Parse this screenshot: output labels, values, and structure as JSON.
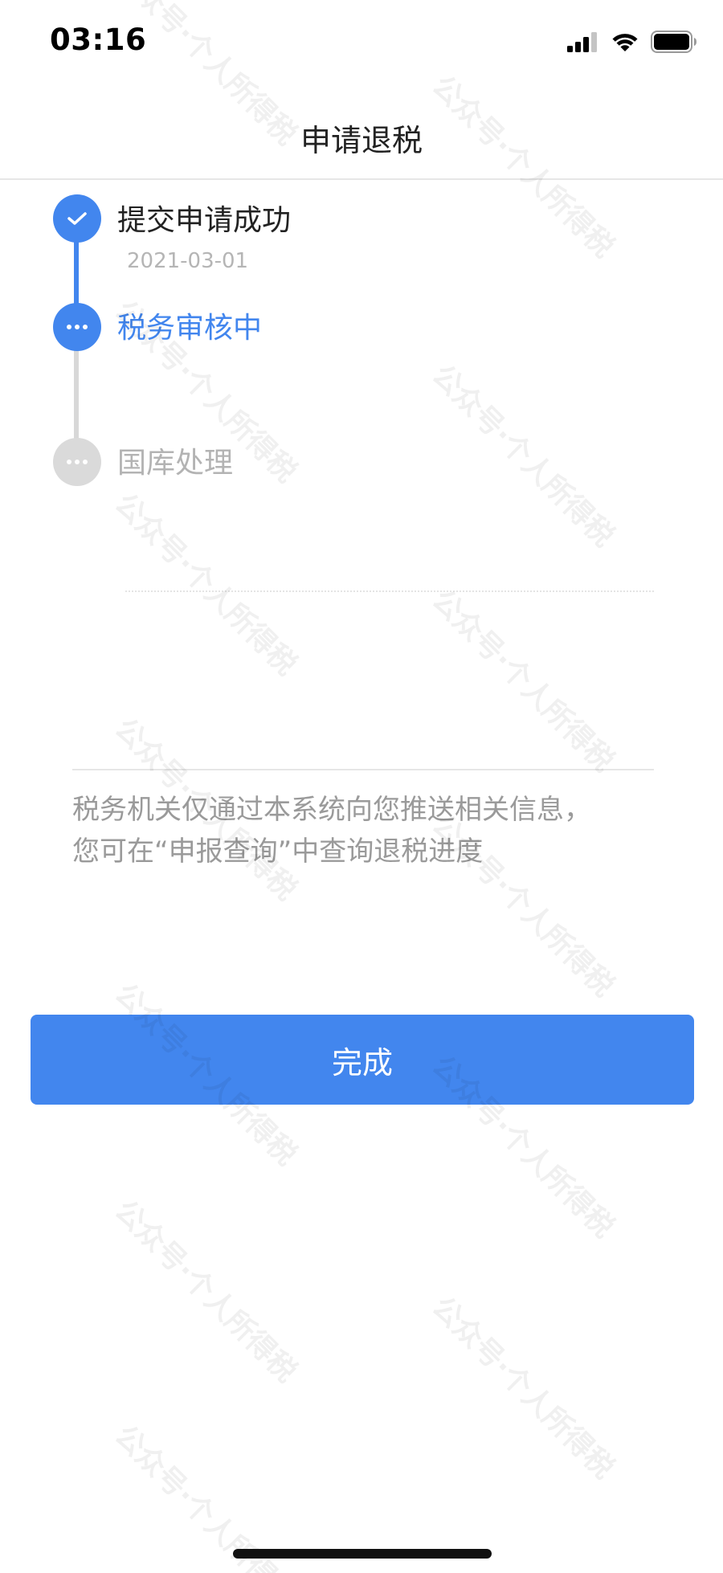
{
  "status_bar": {
    "time": "03:16",
    "icons": [
      "cellular-signal-icon",
      "wifi-icon",
      "battery-icon"
    ]
  },
  "nav": {
    "title": "申请退税"
  },
  "timeline": {
    "steps": [
      {
        "title": "提交申请成功",
        "date": "2021-03-01",
        "state": "done",
        "icon": "check-icon"
      },
      {
        "title": "税务审核中",
        "state": "active",
        "icon": "more-dots-icon"
      },
      {
        "title": "国库处理",
        "state": "pending",
        "icon": "more-dots-icon"
      }
    ]
  },
  "info": {
    "line1": "税务机关仅通过本系统向您推送相关信息，",
    "line2": "您可在“申报查询”中查询退税进度"
  },
  "actions": {
    "done_label": "完成"
  },
  "watermark": {
    "text": "公众号·个人所得税"
  },
  "colors": {
    "accent": "#4286ee",
    "pending": "#d8d8d8",
    "text_primary": "#222222",
    "text_secondary": "#9a9a9a"
  }
}
